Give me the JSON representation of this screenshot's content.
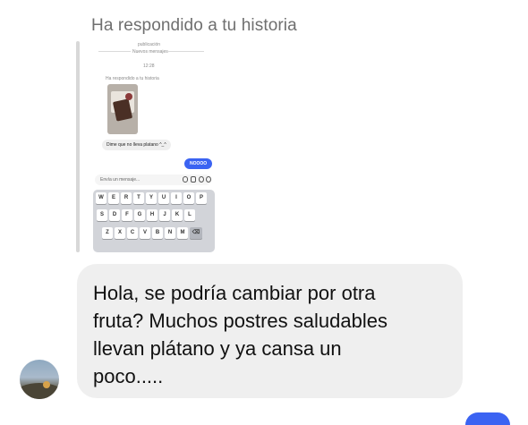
{
  "story_header": "Ha respondido a tu historia",
  "preview": {
    "label_publicacion": "publicación",
    "divider_label": "Nuevos mensajes",
    "time": "12:28",
    "mini_story_header": "Ha respondido a tu historia",
    "incoming_message": "Dime que no lleva platano ^_^",
    "outgoing_message": "NOOOO",
    "input_placeholder": "Envía un mensaje...",
    "keyboard_rows": [
      [
        "W",
        "E",
        "R",
        "T",
        "Y",
        "U",
        "I",
        "O",
        "P"
      ],
      [
        "S",
        "D",
        "F",
        "G",
        "H",
        "J",
        "K",
        "L"
      ],
      [
        "Z",
        "X",
        "C",
        "V",
        "B",
        "N",
        "M"
      ]
    ]
  },
  "reply_message": "Hola, se podría cambiar por otra\nfruta? Muchos  postres saludables\nllevan plátano y ya cansa un\npoco.....",
  "colors": {
    "accent": "#3b63f2",
    "bubble": "#efefef",
    "header_text": "#6f6f6f"
  }
}
